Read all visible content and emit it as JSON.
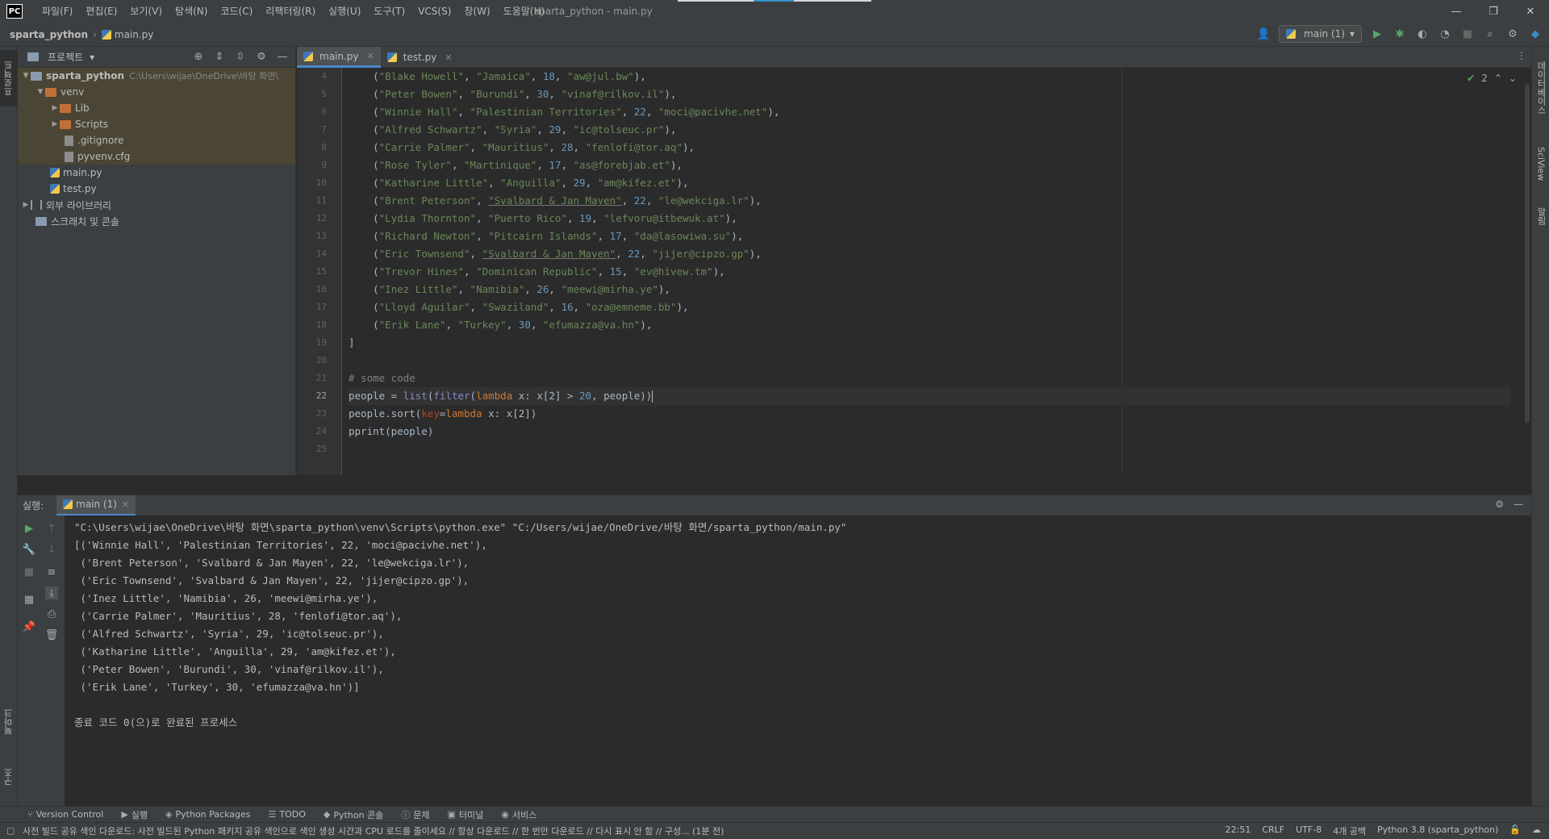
{
  "titlebar": {
    "logo": "PC",
    "menu": [
      "파일(F)",
      "편집(E)",
      "보기(V)",
      "탐색(N)",
      "코드(C)",
      "리팩터링(R)",
      "실행(U)",
      "도구(T)",
      "VCS(S)",
      "창(W)",
      "도움말(H)"
    ],
    "window_title": "sparta_python - main.py",
    "minimize": "—",
    "restore": "❐",
    "close": "✕"
  },
  "navbar": {
    "project": "sparta_python",
    "file": "main.py",
    "run_config": "main (1)"
  },
  "left_strip": {
    "project_tab": "프로젝트",
    "bookmarks_tab": "북마크",
    "structure_tab": "구조"
  },
  "right_strip": {
    "database_tab": "데이터베이스",
    "sciview_tab": "SciView",
    "notifications_tab": "알림"
  },
  "project_panel": {
    "title": "프로젝트",
    "tree": [
      {
        "label": "sparta_python",
        "hint": "C:\\Users\\wijae\\OneDrive\\바탕 화면\\",
        "level": 0
      },
      {
        "label": "venv",
        "level": 1
      },
      {
        "label": "Lib",
        "level": 2
      },
      {
        "label": "Scripts",
        "level": 2
      },
      {
        "label": ".gitignore",
        "level": 2
      },
      {
        "label": "pyvenv.cfg",
        "level": 2
      },
      {
        "label": "main.py",
        "level": 1
      },
      {
        "label": "test.py",
        "level": 1
      },
      {
        "label": "외부 라이브러리",
        "level": 0
      },
      {
        "label": "스크래치 및 콘솔",
        "level": 0
      }
    ]
  },
  "editor": {
    "tabs": [
      {
        "label": "main.py",
        "active": true
      },
      {
        "label": "test.py",
        "active": false
      }
    ],
    "inspection_count": "2",
    "line_numbers": [
      "4",
      "5",
      "6",
      "7",
      "8",
      "9",
      "10",
      "11",
      "12",
      "13",
      "14",
      "15",
      "16",
      "17",
      "18",
      "19",
      "20",
      "21",
      "22",
      "23",
      "24",
      "25"
    ],
    "current_line": "22",
    "records": [
      {
        "name": "\"Blake Howell\"",
        "country": "\"Jamaica\"",
        "age": "18",
        "email": "\"aw@jul.bw\""
      },
      {
        "name": "\"Peter Bowen\"",
        "country": "\"Burundi\"",
        "age": "30",
        "email": "\"vinaf@rilkov.il\""
      },
      {
        "name": "\"Winnie Hall\"",
        "country": "\"Palestinian Territories\"",
        "age": "22",
        "email": "\"moci@pacivhe.net\""
      },
      {
        "name": "\"Alfred Schwartz\"",
        "country": "\"Syria\"",
        "age": "29",
        "email": "\"ic@tolseuc.pr\""
      },
      {
        "name": "\"Carrie Palmer\"",
        "country": "\"Mauritius\"",
        "age": "28",
        "email": "\"fenlofi@tor.aq\""
      },
      {
        "name": "\"Rose Tyler\"",
        "country": "\"Martinique\"",
        "age": "17",
        "email": "\"as@forebjab.et\""
      },
      {
        "name": "\"Katharine Little\"",
        "country": "\"Anguilla\"",
        "age": "29",
        "email": "\"am@kifez.et\""
      },
      {
        "name": "\"Brent Peterson\"",
        "country": "\"Svalbard & Jan Mayen\"",
        "age": "22",
        "email": "\"le@wekciga.lr\""
      },
      {
        "name": "\"Lydia Thornton\"",
        "country": "\"Puerto Rico\"",
        "age": "19",
        "email": "\"lefvoru@itbewuk.at\""
      },
      {
        "name": "\"Richard Newton\"",
        "country": "\"Pitcairn Islands\"",
        "age": "17",
        "email": "\"da@lasowiwa.su\""
      },
      {
        "name": "\"Eric Townsend\"",
        "country": "\"Svalbard & Jan Mayen\"",
        "age": "22",
        "email": "\"jijer@cipzo.gp\""
      },
      {
        "name": "\"Trevor Hines\"",
        "country": "\"Dominican Republic\"",
        "age": "15",
        "email": "\"ev@hivew.tm\""
      },
      {
        "name": "\"Inez Little\"",
        "country": "\"Namibia\"",
        "age": "26",
        "email": "\"meewi@mirha.ye\""
      },
      {
        "name": "\"Lloyd Aguilar\"",
        "country": "\"Swaziland\"",
        "age": "16",
        "email": "\"oza@emneme.bb\""
      },
      {
        "name": "\"Erik Lane\"",
        "country": "\"Turkey\"",
        "age": "30",
        "email": "\"efumazza@va.hn\""
      }
    ],
    "closing_bracket": "]",
    "comment": "# some code",
    "line22": {
      "var": "people = ",
      "list": "list",
      "open": "(",
      "filter": "filter",
      "open2": "(",
      "lambda": "lambda",
      "body": " x: x[2] > ",
      "num": "20",
      "tail": ", people))"
    },
    "line23": {
      "head": "people.sort(",
      "kw": "key",
      "eq": "=",
      "lambda": "lambda",
      "tail": " x: x[2])"
    },
    "line24": "pprint(people)"
  },
  "run_panel": {
    "label": "실행:",
    "tab": "main (1)",
    "output": [
      "\"C:\\Users\\wijae\\OneDrive\\바탕 화면\\sparta_python\\venv\\Scripts\\python.exe\" \"C:/Users/wijae/OneDrive/바탕 화면/sparta_python/main.py\"",
      "[('Winnie Hall', 'Palestinian Territories', 22, 'moci@pacivhe.net'),",
      " ('Brent Peterson', 'Svalbard & Jan Mayen', 22, 'le@wekciga.lr'),",
      " ('Eric Townsend', 'Svalbard & Jan Mayen', 22, 'jijer@cipzo.gp'),",
      " ('Inez Little', 'Namibia', 26, 'meewi@mirha.ye'),",
      " ('Carrie Palmer', 'Mauritius', 28, 'fenlofi@tor.aq'),",
      " ('Alfred Schwartz', 'Syria', 29, 'ic@tolseuc.pr'),",
      " ('Katharine Little', 'Anguilla', 29, 'am@kifez.et'),",
      " ('Peter Bowen', 'Burundi', 30, 'vinaf@rilkov.il'),",
      " ('Erik Lane', 'Turkey', 30, 'efumazza@va.hn')]",
      "",
      "종료 코드 0(으)로 완료된 프로세스"
    ]
  },
  "toolwindows": [
    "Version Control",
    "실행",
    "Python Packages",
    "TODO",
    "Python 콘솔",
    "문제",
    "터미널",
    "서비스"
  ],
  "statusbar": {
    "message": "사전 빌드 공유 색인 다운로드: 사전 빌드된 Python 패키지 공유 색인으로 색인 생성 시간과 CPU 로드를 줄이세요 // 항상 다운로드 // 한 번만 다운로드 // 다시 표시 안 함 // 구성... (1분 전)",
    "position": "22:51",
    "line_sep": "CRLF",
    "encoding": "UTF-8",
    "indent": "4개 공백",
    "interpreter": "Python 3.8 (sparta_python)"
  },
  "colors": {
    "accent": "#4a88c7",
    "string": "#6a8759",
    "number": "#6897bb",
    "keyword": "#cc7832",
    "run_green": "#59a869"
  }
}
